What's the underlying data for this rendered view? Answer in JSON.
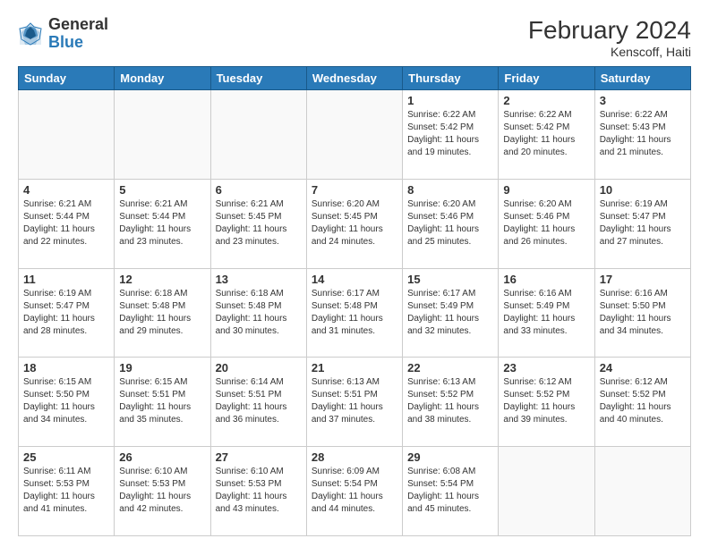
{
  "header": {
    "logo_general": "General",
    "logo_blue": "Blue",
    "month_year": "February 2024",
    "location": "Kenscoff, Haiti"
  },
  "days_of_week": [
    "Sunday",
    "Monday",
    "Tuesday",
    "Wednesday",
    "Thursday",
    "Friday",
    "Saturday"
  ],
  "weeks": [
    [
      {
        "day": "",
        "info": ""
      },
      {
        "day": "",
        "info": ""
      },
      {
        "day": "",
        "info": ""
      },
      {
        "day": "",
        "info": ""
      },
      {
        "day": "1",
        "info": "Sunrise: 6:22 AM\nSunset: 5:42 PM\nDaylight: 11 hours and 19 minutes."
      },
      {
        "day": "2",
        "info": "Sunrise: 6:22 AM\nSunset: 5:42 PM\nDaylight: 11 hours and 20 minutes."
      },
      {
        "day": "3",
        "info": "Sunrise: 6:22 AM\nSunset: 5:43 PM\nDaylight: 11 hours and 21 minutes."
      }
    ],
    [
      {
        "day": "4",
        "info": "Sunrise: 6:21 AM\nSunset: 5:44 PM\nDaylight: 11 hours and 22 minutes."
      },
      {
        "day": "5",
        "info": "Sunrise: 6:21 AM\nSunset: 5:44 PM\nDaylight: 11 hours and 23 minutes."
      },
      {
        "day": "6",
        "info": "Sunrise: 6:21 AM\nSunset: 5:45 PM\nDaylight: 11 hours and 23 minutes."
      },
      {
        "day": "7",
        "info": "Sunrise: 6:20 AM\nSunset: 5:45 PM\nDaylight: 11 hours and 24 minutes."
      },
      {
        "day": "8",
        "info": "Sunrise: 6:20 AM\nSunset: 5:46 PM\nDaylight: 11 hours and 25 minutes."
      },
      {
        "day": "9",
        "info": "Sunrise: 6:20 AM\nSunset: 5:46 PM\nDaylight: 11 hours and 26 minutes."
      },
      {
        "day": "10",
        "info": "Sunrise: 6:19 AM\nSunset: 5:47 PM\nDaylight: 11 hours and 27 minutes."
      }
    ],
    [
      {
        "day": "11",
        "info": "Sunrise: 6:19 AM\nSunset: 5:47 PM\nDaylight: 11 hours and 28 minutes."
      },
      {
        "day": "12",
        "info": "Sunrise: 6:18 AM\nSunset: 5:48 PM\nDaylight: 11 hours and 29 minutes."
      },
      {
        "day": "13",
        "info": "Sunrise: 6:18 AM\nSunset: 5:48 PM\nDaylight: 11 hours and 30 minutes."
      },
      {
        "day": "14",
        "info": "Sunrise: 6:17 AM\nSunset: 5:48 PM\nDaylight: 11 hours and 31 minutes."
      },
      {
        "day": "15",
        "info": "Sunrise: 6:17 AM\nSunset: 5:49 PM\nDaylight: 11 hours and 32 minutes."
      },
      {
        "day": "16",
        "info": "Sunrise: 6:16 AM\nSunset: 5:49 PM\nDaylight: 11 hours and 33 minutes."
      },
      {
        "day": "17",
        "info": "Sunrise: 6:16 AM\nSunset: 5:50 PM\nDaylight: 11 hours and 34 minutes."
      }
    ],
    [
      {
        "day": "18",
        "info": "Sunrise: 6:15 AM\nSunset: 5:50 PM\nDaylight: 11 hours and 34 minutes."
      },
      {
        "day": "19",
        "info": "Sunrise: 6:15 AM\nSunset: 5:51 PM\nDaylight: 11 hours and 35 minutes."
      },
      {
        "day": "20",
        "info": "Sunrise: 6:14 AM\nSunset: 5:51 PM\nDaylight: 11 hours and 36 minutes."
      },
      {
        "day": "21",
        "info": "Sunrise: 6:13 AM\nSunset: 5:51 PM\nDaylight: 11 hours and 37 minutes."
      },
      {
        "day": "22",
        "info": "Sunrise: 6:13 AM\nSunset: 5:52 PM\nDaylight: 11 hours and 38 minutes."
      },
      {
        "day": "23",
        "info": "Sunrise: 6:12 AM\nSunset: 5:52 PM\nDaylight: 11 hours and 39 minutes."
      },
      {
        "day": "24",
        "info": "Sunrise: 6:12 AM\nSunset: 5:52 PM\nDaylight: 11 hours and 40 minutes."
      }
    ],
    [
      {
        "day": "25",
        "info": "Sunrise: 6:11 AM\nSunset: 5:53 PM\nDaylight: 11 hours and 41 minutes."
      },
      {
        "day": "26",
        "info": "Sunrise: 6:10 AM\nSunset: 5:53 PM\nDaylight: 11 hours and 42 minutes."
      },
      {
        "day": "27",
        "info": "Sunrise: 6:10 AM\nSunset: 5:53 PM\nDaylight: 11 hours and 43 minutes."
      },
      {
        "day": "28",
        "info": "Sunrise: 6:09 AM\nSunset: 5:54 PM\nDaylight: 11 hours and 44 minutes."
      },
      {
        "day": "29",
        "info": "Sunrise: 6:08 AM\nSunset: 5:54 PM\nDaylight: 11 hours and 45 minutes."
      },
      {
        "day": "",
        "info": ""
      },
      {
        "day": "",
        "info": ""
      }
    ]
  ]
}
